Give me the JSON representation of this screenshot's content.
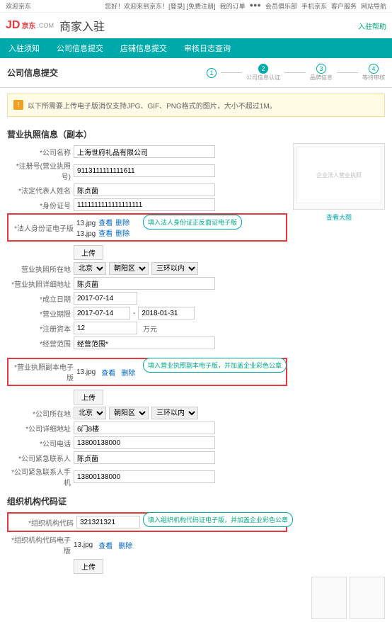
{
  "topbar": {
    "left": "欢迎京东",
    "center": "您好！欢迎来到京东！[登录] [免费注册]",
    "links": [
      "我的订单",
      "●●●",
      "会员俱乐部",
      "手机京东",
      "客户服务",
      "网站导航"
    ]
  },
  "header": {
    "logo": "JD",
    "logo_sub": "京东",
    "dotcom": ".COM",
    "title": "商家入驻",
    "help": "入驻帮助"
  },
  "tabs": [
    "入驻须知",
    "公司信息提交",
    "店铺信息提交",
    "审核日志查询"
  ],
  "section": {
    "title": "公司信息提交"
  },
  "steps": [
    "1",
    "公司信息认证",
    "品牌信息",
    "等待审核"
  ],
  "notice": "以下所需要上传电子版消仅支持JPG、GIF、PNG格式的图片，大小不超过1M。",
  "group1": {
    "title": "营业执照信息（副本）"
  },
  "fields": {
    "company_lbl": "*公司名称",
    "company_val": "上海世府礼品有限公司",
    "regno_lbl": "*注册号(营业执照号)",
    "regno_val": "9113111111111611",
    "legal_lbl": "*法定代表人姓名",
    "legal_val": "陈贞菌",
    "idno_lbl": "*身份证号",
    "idno_val": "1111111111111111111",
    "idfile_lbl": "*法人身份证电子版",
    "file_name": "13.jpg",
    "view": "查看",
    "delete": "删除",
    "upload": "上传",
    "callout_id": "填入法人身份证正反面证电子版",
    "loc_lbl": "营业执照所在地",
    "loc_city": "北京",
    "loc_dist": "朝阳区",
    "loc_ring": "三环以内",
    "addr_lbl": "*营业执照详细地址",
    "addr_val": "陈贞菌",
    "estdate_lbl": "*成立日期",
    "estdate_val": "2017-07-14",
    "period_lbl": "*营业期限",
    "period_s": "2017-07-14",
    "period_e": "2018-01-31",
    "capital_lbl": "*注册资本",
    "capital_val": "12",
    "capital_unit": "万元",
    "scope_lbl": "*经营范围",
    "scope_val": "经营范围*",
    "license_lbl": "*营业执照副本电子版",
    "callout_license": "填入营业执照副本电子版，并加盖企业彩色公章",
    "coaddr_lbl": "*公司所在地",
    "codetail_lbl": "*公司详细地址",
    "codetail_val": "6门8楼",
    "tel_lbl": "*公司电话",
    "tel_val": "13800138000",
    "contact_lbl": "*公司紧急联系人",
    "contact_val": "陈贞菌",
    "mobile_lbl": "*公司紧急联系人手机",
    "mobile_val": "13800138000"
  },
  "group2": {
    "title": "组织机构代码证"
  },
  "org": {
    "code_lbl": "*组织机构代码",
    "code_val": "321321321",
    "file_lbl": "*组织机构代码电子版",
    "callout_org": "填入组织机构代码证电子版，并加盖企业彩色公章"
  },
  "example": {
    "title": "企业法人营业执照",
    "link": "查看大图"
  }
}
